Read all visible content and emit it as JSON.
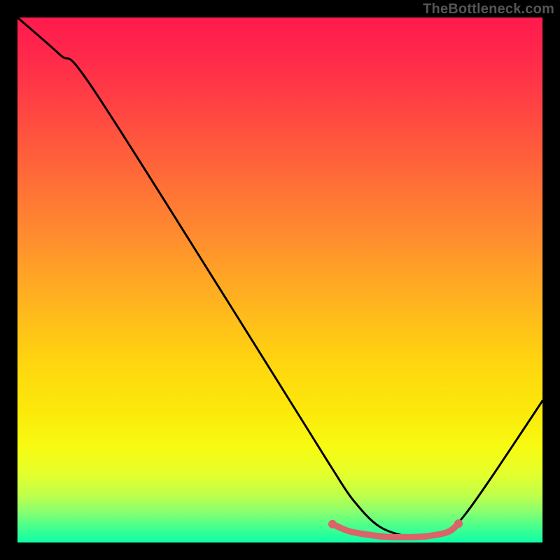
{
  "watermark": "TheBottleneck.com",
  "chart_data": {
    "type": "line",
    "title": "",
    "xlabel": "",
    "ylabel": "",
    "xlim": [
      0,
      100
    ],
    "ylim": [
      0,
      100
    ],
    "grid": false,
    "color_gradient": "vertical red-yellow-green representing bottleneck severity (red high, green low)",
    "series": [
      {
        "name": "bottleneck-curve",
        "color": "#000000",
        "x": [
          0,
          8,
          14,
          40,
          55,
          60,
          64,
          69,
          75,
          79,
          82,
          85,
          90,
          100
        ],
        "y": [
          100,
          93,
          87,
          46,
          22,
          14,
          8,
          3,
          1,
          1,
          2,
          5,
          12,
          27
        ]
      },
      {
        "name": "optimal-range-marker",
        "color": "#d9646a",
        "x": [
          60,
          63,
          66,
          70,
          74,
          78,
          82,
          84
        ],
        "y": [
          3.5,
          2.2,
          1.6,
          1.1,
          1.0,
          1.2,
          2.0,
          3.6
        ]
      }
    ],
    "annotations": []
  }
}
